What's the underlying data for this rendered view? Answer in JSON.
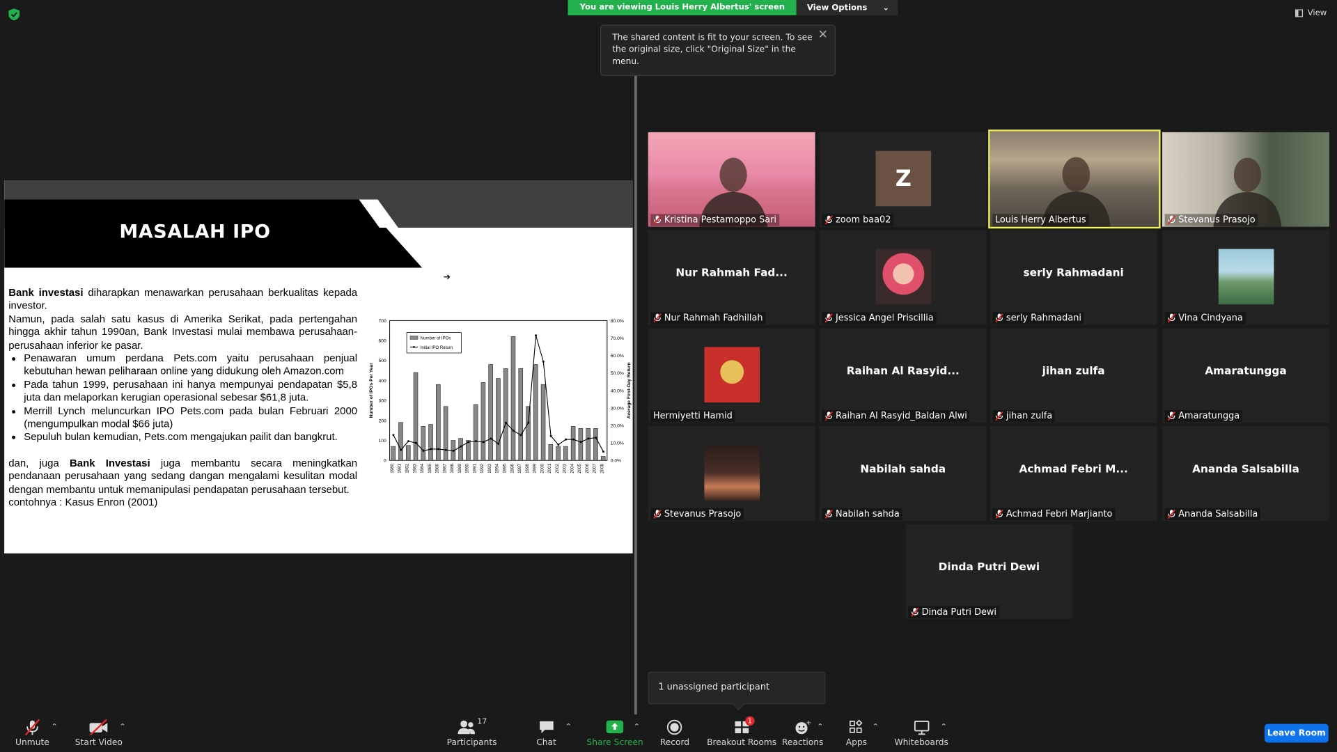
{
  "banner": {
    "viewing": "You are viewing Louis Herry Albertus' screen",
    "options": "View Options"
  },
  "top_right": {
    "view": "View"
  },
  "tooltip": {
    "text": "The shared content is fit to your screen. To see the original size, click \"Original Size\" in the menu."
  },
  "slide": {
    "title": "MASALAH IPO",
    "p1_bold": "Bank investasi",
    "p1_rest": " diharapkan menawarkan perusahaan berkualitas kepada investor.",
    "p2": "Namun, pada salah satu kasus di Amerika Serikat, pada pertengahan hingga akhir tahun 1990an, Bank Investasi mulai membawa perusahaan-perusahaan inferior ke pasar.",
    "bullets": [
      "Penawaran umum perdana Pets.com yaitu perusahaan penjual kebutuhan hewan peliharaan online yang didukung oleh Amazon.com",
      "Pada tahun 1999, perusahaan ini hanya mempunyai pendapatan $5,8 juta dan melaporkan kerugian operasional sebesar $61,8 juta.",
      "Merrill Lynch meluncurkan IPO Pets.com pada bulan Februari 2000 (mengumpulkan modal $66 juta)",
      "Sepuluh bulan kemudian, Pets.com mengajukan pailit dan bangkrut."
    ],
    "p3_a": "dan, juga ",
    "p3_bold": "Bank Investasi",
    "p3_rest": " juga membantu secara meningkatkan pendanaan perusahaan yang sedang dangan mengalami kesulitan modal dengan membantu untuk memanipulasi pendapatan perusahaan tersebut.",
    "p4": "contohnya : Kasus Enron (2001)"
  },
  "chart_data": {
    "type": "bar",
    "categories": [
      "1980",
      "1981",
      "1982",
      "1983",
      "1984",
      "1985",
      "1986",
      "1987",
      "1988",
      "1989",
      "1990",
      "1991",
      "1992",
      "1993",
      "1994",
      "1995",
      "1996",
      "1997",
      "1998",
      "1999",
      "2000",
      "2001",
      "2002",
      "2003",
      "2004",
      "2005",
      "2006",
      "2007",
      "2008"
    ],
    "series": [
      {
        "name": "Number of IPOs",
        "type": "bar",
        "axis": "left",
        "values": [
          70,
          190,
          75,
          440,
          170,
          180,
          380,
          270,
          100,
          110,
          100,
          280,
          390,
          480,
          410,
          460,
          620,
          460,
          270,
          480,
          380,
          80,
          70,
          70,
          170,
          160,
          160,
          160,
          20
        ]
      },
      {
        "name": "Initial IPO Return",
        "type": "line",
        "axis": "right",
        "values": [
          14.5,
          6.0,
          11.0,
          10.0,
          5.5,
          6.5,
          6.5,
          6.0,
          5.5,
          8.0,
          10.5,
          11.0,
          10.5,
          12.5,
          9.5,
          21.5,
          17.0,
          14.5,
          21.5,
          71.5,
          56.5,
          14.0,
          9.0,
          12.0,
          12.0,
          10.5,
          12.5,
          13.0,
          5.0
        ]
      }
    ],
    "ylabel": "Number of IPOs Per Year",
    "y2label": "Average First-Day Return",
    "ylim": [
      0,
      700
    ],
    "y2lim": [
      0,
      80
    ],
    "yticks": [
      "0",
      "100",
      "200",
      "300",
      "400",
      "500",
      "600",
      "700"
    ],
    "y2ticks": [
      "0.0%",
      "10.0%",
      "20.0%",
      "30.0%",
      "40.0%",
      "50.0%",
      "60.0%",
      "70.0%",
      "80.0%"
    ],
    "legend": "top-left"
  },
  "participants": [
    {
      "name": "Kristina Pestamoppo Sari",
      "kind": "video"
    },
    {
      "name": "zoom baa02",
      "kind": "letter",
      "letter": "Z"
    },
    {
      "name": "Louis Herry Albertus",
      "kind": "video",
      "active": true
    },
    {
      "name": "Stevanus Prasojo",
      "kind": "video"
    },
    {
      "name": "Nur Rahmah Fadhillah",
      "display": "Nur Rahmah Fad..."
    },
    {
      "name": "Jessica Angel Priscillia",
      "kind": "avatar"
    },
    {
      "name": "serly Rahmadani",
      "display": "serly Rahmadani"
    },
    {
      "name": "Vina Cindyana",
      "kind": "avatar"
    },
    {
      "name": "Hermiyetti Hamid",
      "kind": "avatar"
    },
    {
      "name": "Raihan Al Rasyid_Baldan Alwi",
      "display": "Raihan Al Rasyid..."
    },
    {
      "name": "jihan zulfa",
      "display": "jihan zulfa"
    },
    {
      "name": "Amaratungga",
      "display": "Amaratungga"
    },
    {
      "name": "Stevanus Prasojo",
      "kind": "avatar"
    },
    {
      "name": "Nabilah sahda",
      "display": "Nabilah sahda"
    },
    {
      "name": "Achmad Febri Marjianto",
      "display": "Achmad Febri M..."
    },
    {
      "name": "Ananda Salsabilla",
      "display": "Ananda Salsabilla"
    },
    {
      "name": "Dinda Putri Dewi",
      "display": "Dinda Putri Dewi"
    }
  ],
  "unassigned": "1 unassigned participant",
  "toolbar": {
    "unmute": "Unmute",
    "start_video": "Start Video",
    "participants": "Participants",
    "participants_count": "17",
    "chat": "Chat",
    "share": "Share Screen",
    "record": "Record",
    "breakout": "Breakout Rooms",
    "breakout_badge": "1",
    "reactions": "Reactions",
    "apps": "Apps",
    "whiteboards": "Whiteboards",
    "leave": "Leave Room"
  }
}
